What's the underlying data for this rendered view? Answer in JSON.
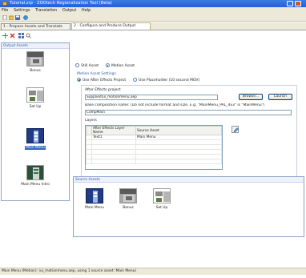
{
  "window": {
    "title": "Tutorial.zrp - ZOOtech Regionalization Tool (Beta)"
  },
  "menu": [
    "File",
    "Settings",
    "Translation",
    "Output",
    "Help"
  ],
  "toolbar": {
    "icons": [
      "new-icon",
      "open-icon",
      "save-icon",
      "globe-icon"
    ]
  },
  "tabs": [
    {
      "label": "1 - Prepare Assets and Translate",
      "active": false
    },
    {
      "label": "2 - Configure and Produce Output",
      "active": true
    }
  ],
  "output_assets": {
    "header": "Output Assets",
    "tool_icons": [
      "add-icon",
      "remove-icon",
      "grid-icon",
      "search-icon"
    ],
    "items": [
      {
        "label": "Bonus"
      },
      {
        "label": "Set Up"
      },
      {
        "label": "Main Menu",
        "selected": true
      },
      {
        "label": "Main Menu Intro"
      }
    ]
  },
  "asset_type": {
    "still_label": "Still Asset",
    "motion_label": "Motion Asset",
    "selected": "motion"
  },
  "motion_settings": {
    "title": "Motion Asset Settings",
    "use_ae_label": "Use After Effects Project",
    "use_placeholder_label": "Use Placeholder (10 second MOV)",
    "selected": "ae"
  },
  "ae_project": {
    "label": "After Effects project",
    "value": "Supplied\\ui_motionmenu.aep",
    "browse_label": "Browse...",
    "launch_label": "Launch"
  },
  "base_comp": {
    "label": "Base composition name: (Do not include format and size. E.g. \"MainMenu_PAL_4x3\" is \"MainMenu\")",
    "value": "CompMain"
  },
  "layers": {
    "label": "Layers",
    "columns": [
      "After Effects Layer Name",
      "Source Asset"
    ],
    "rows": [
      [
        "Text1",
        "Main Menu"
      ]
    ]
  },
  "source_assets": {
    "header": "Source Assets",
    "items": [
      {
        "label": "Main Menu"
      },
      {
        "label": "Bonus"
      },
      {
        "label": "Set Up"
      }
    ]
  },
  "status": {
    "text": "Main Menu (Motion): \\ui_motionmenu.aep, using 1 source asset: Main Menu)"
  }
}
